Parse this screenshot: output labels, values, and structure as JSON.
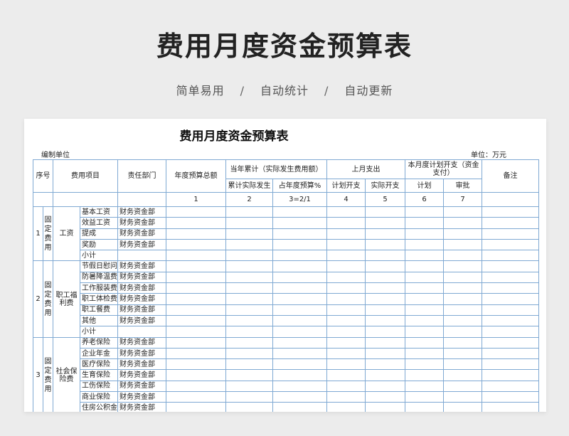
{
  "hero": {
    "title": "费用月度资金预算表",
    "tags": [
      "简单易用",
      "自动统计",
      "自动更新"
    ],
    "separator": "/"
  },
  "sheet": {
    "title": "费用月度资金预算表",
    "unit_left": "编制单位",
    "unit_right": "单位：万元",
    "headers": {
      "seq": "序号",
      "item": "费用项目",
      "dept": "责任部门",
      "annual_total": "年度预算总额",
      "ytd_group": "当年累计（实际发生费用额）",
      "ytd_actual": "累计实际发生",
      "ytd_pct": "占年度预算%",
      "last_month_group": "上月支出",
      "plan_spend": "计划开支",
      "actual_spend": "实际开支",
      "this_month_group": "本月度计划开支（资金支付）",
      "plan": "计划",
      "approve": "审批",
      "remark": "备注"
    },
    "col_numbers": [
      "1",
      "2",
      "3=2/1",
      "4",
      "5",
      "6",
      "7"
    ],
    "groups": [
      {
        "seq": "1",
        "category": "固定费用",
        "subgroup": "工资",
        "items": [
          {
            "name": "基本工资",
            "dept": "财务资金部"
          },
          {
            "name": "效益工资",
            "dept": "财务资金部"
          },
          {
            "name": "提成",
            "dept": "财务资金部"
          },
          {
            "name": "奖励",
            "dept": "财务资金部"
          },
          {
            "name": "小计",
            "dept": ""
          }
        ]
      },
      {
        "seq": "2",
        "category": "固定费用",
        "subgroup": "职工福利费",
        "items": [
          {
            "name": "节假日慰问",
            "dept": "财务资金部"
          },
          {
            "name": "防暑降温费",
            "dept": "财务资金部"
          },
          {
            "name": "工作服装费",
            "dept": "财务资金部"
          },
          {
            "name": "职工体检费",
            "dept": "财务资金部"
          },
          {
            "name": "职工餐费",
            "dept": "财务资金部"
          },
          {
            "name": "其他",
            "dept": "财务资金部"
          },
          {
            "name": "小计",
            "dept": ""
          }
        ]
      },
      {
        "seq": "3",
        "category": "固定费用",
        "subgroup": "社会保险费",
        "items": [
          {
            "name": "养老保险",
            "dept": "财务资金部"
          },
          {
            "name": "企业年金",
            "dept": "财务资金部"
          },
          {
            "name": "医疗保险",
            "dept": "财务资金部"
          },
          {
            "name": "生育保险",
            "dept": "财务资金部"
          },
          {
            "name": "工伤保险",
            "dept": "财务资金部"
          },
          {
            "name": "商业保险",
            "dept": "财务资金部"
          },
          {
            "name": "住房公积金",
            "dept": "财务资金部"
          }
        ]
      }
    ]
  }
}
